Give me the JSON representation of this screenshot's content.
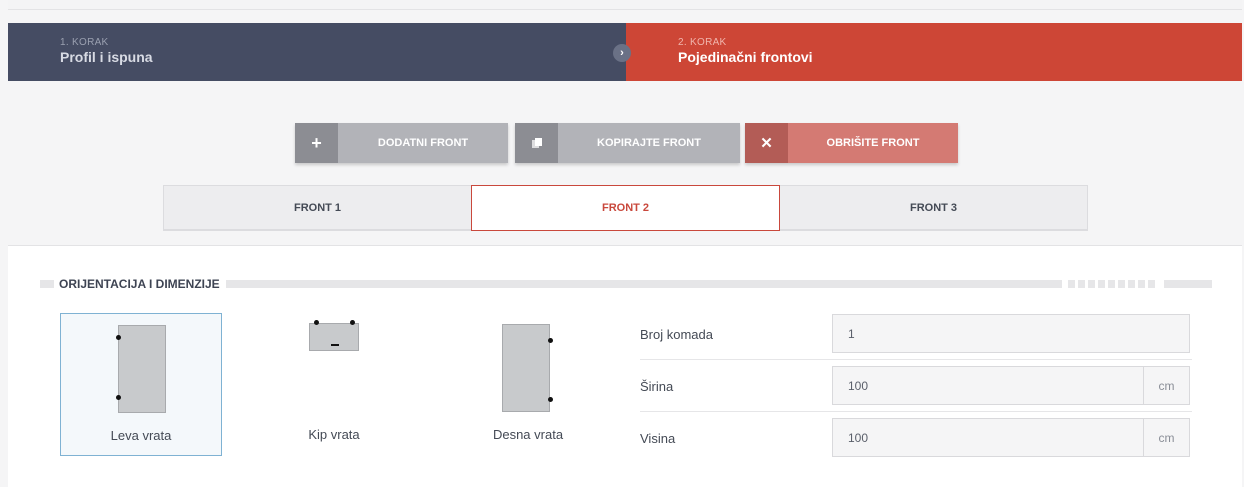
{
  "stepper": {
    "steps": [
      {
        "number": "1. KORAK",
        "title": "Profil i ispuna"
      },
      {
        "number": "2. KORAK",
        "title": "Pojedinačni frontovi"
      }
    ],
    "arrow_glyph": "›"
  },
  "actions": {
    "add": {
      "label": "DODATNI FRONT",
      "icon": "plus-icon",
      "glyph": "+"
    },
    "copy": {
      "label": "KOPIRAJTE FRONT",
      "icon": "copy-icon"
    },
    "delete": {
      "label": "OBRIŠITE FRONT",
      "icon": "close-icon",
      "glyph": "✕"
    }
  },
  "tabs": [
    {
      "label": "FRONT 1",
      "active": false
    },
    {
      "label": "FRONT 2",
      "active": true
    },
    {
      "label": "FRONT 3",
      "active": false
    }
  ],
  "section": {
    "title": "ORIJENTACIJA I DIMENZIJE"
  },
  "orientation": {
    "options": [
      {
        "label": "Leva vrata",
        "selected": true
      },
      {
        "label": "Kip vrata",
        "selected": false
      },
      {
        "label": "Desna vrata",
        "selected": false
      }
    ]
  },
  "fields": {
    "quantity": {
      "label": "Broj komada",
      "value": "1"
    },
    "width": {
      "label": "Širina",
      "value": "100",
      "unit": "cm"
    },
    "height": {
      "label": "Visina",
      "value": "100",
      "unit": "cm"
    }
  },
  "colors": {
    "step_inactive": "#454c63",
    "step_active": "#cd4636",
    "accent": "#c9483c",
    "selected_border": "#7fb2d3"
  }
}
